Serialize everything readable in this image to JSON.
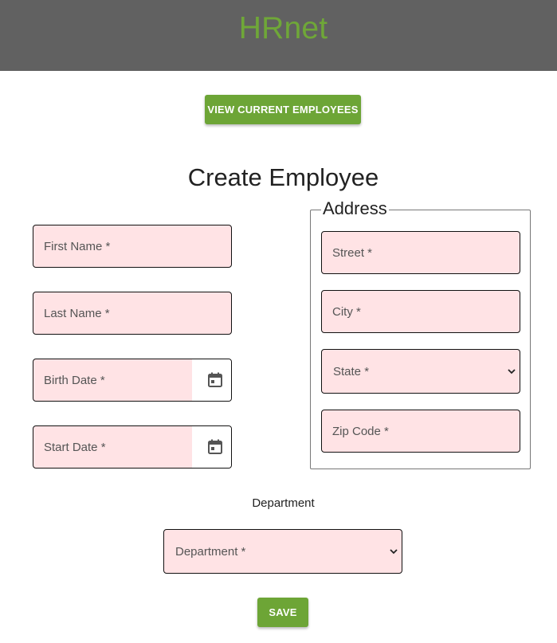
{
  "header": {
    "title": "HRnet",
    "background_color": "#616161",
    "title_color": "#6fa738"
  },
  "actions": {
    "view_employees_label": "VIEW CURRENT EMPLOYEES",
    "save_label": "SAVE",
    "button_color": "#6da536"
  },
  "form": {
    "title": "Create Employee",
    "first_name_placeholder": "First Name *",
    "last_name_placeholder": "Last Name *",
    "birth_date_placeholder": "Birth Date *",
    "start_date_placeholder": "Start Date *",
    "field_background": "#ffe3e5",
    "address": {
      "legend": "Address",
      "street_placeholder": "Street *",
      "city_placeholder": "City *",
      "state_selected": "State *",
      "zip_placeholder": "Zip Code *"
    },
    "department": {
      "label": "Department",
      "selected": "Department *"
    }
  },
  "icons": {
    "date_picker": "calendar-icon",
    "select_arrow": "chevron-down-icon"
  }
}
